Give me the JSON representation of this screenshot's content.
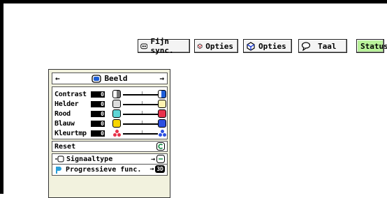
{
  "tabs": [
    {
      "label": "Fijn sync.",
      "icon": "fine-sync-icon"
    },
    {
      "label": "Opties",
      "icon": "options-red-icon"
    },
    {
      "label": "Opties",
      "icon": "options-blue-icon"
    },
    {
      "label": "Taal",
      "icon": "speech-bubble-icon"
    },
    {
      "label": "Status",
      "icon": ""
    }
  ],
  "menu": {
    "title": "Beeld",
    "left_arrow": "←",
    "right_arrow": "→",
    "sliders": [
      {
        "label": "Contrast",
        "value": "0",
        "color": "#1e5fd8"
      },
      {
        "label": "Helder",
        "value": "0",
        "color": "#c79a00"
      },
      {
        "label": "Rood",
        "value": "0",
        "color": "#e8334a"
      },
      {
        "label": "Blauw",
        "value": "0",
        "color": "#2b4fe0"
      },
      {
        "label": "Kleurtmp",
        "value": "0",
        "color": "#d12d6a"
      }
    ],
    "reset_label": "Reset",
    "submenus": [
      {
        "label": "Signaaltype",
        "arrow": "→"
      },
      {
        "label": "Progressieve func.",
        "arrow": "→",
        "badge": "3D"
      }
    ]
  }
}
